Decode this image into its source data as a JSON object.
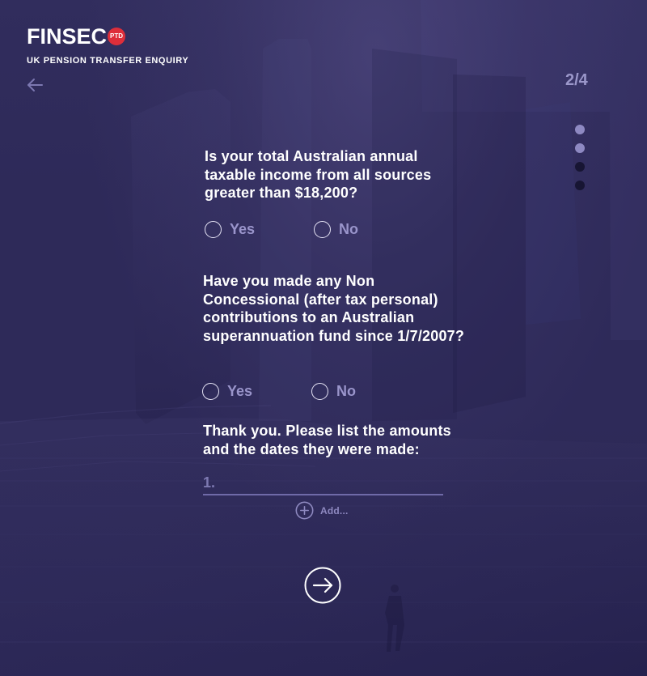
{
  "header": {
    "logo_text": "FINSEC",
    "logo_badge": "PTD",
    "subtitle": "UK PENSION TRANSFER ENQUIRY",
    "step_counter": "2/4"
  },
  "progress": {
    "current_step": 2,
    "total_steps": 4
  },
  "questions": {
    "q1": {
      "text": "Is your total Australian annual taxable income from all sources greater than $18,200?",
      "options": {
        "yes": "Yes",
        "no": "No"
      }
    },
    "q2": {
      "text": "Have you made any Non Concessional (after tax personal) contributions to an Australian superannuation fund since 1/7/2007?",
      "options": {
        "yes": "Yes",
        "no": "No"
      }
    },
    "q3": {
      "text": "Thank you. Please list the amounts and the dates they were made:"
    }
  },
  "amount_entry": {
    "placeholder": "1.",
    "value": "",
    "add_label": "Add..."
  },
  "icons": {
    "back": "arrow-left-icon",
    "add": "plus-circle-icon",
    "next": "arrow-right-circle-icon"
  },
  "colors": {
    "background": "#2f2b57",
    "text": "#ffffff",
    "muted": "#9a95cb",
    "brand_red": "#de2e3a"
  }
}
